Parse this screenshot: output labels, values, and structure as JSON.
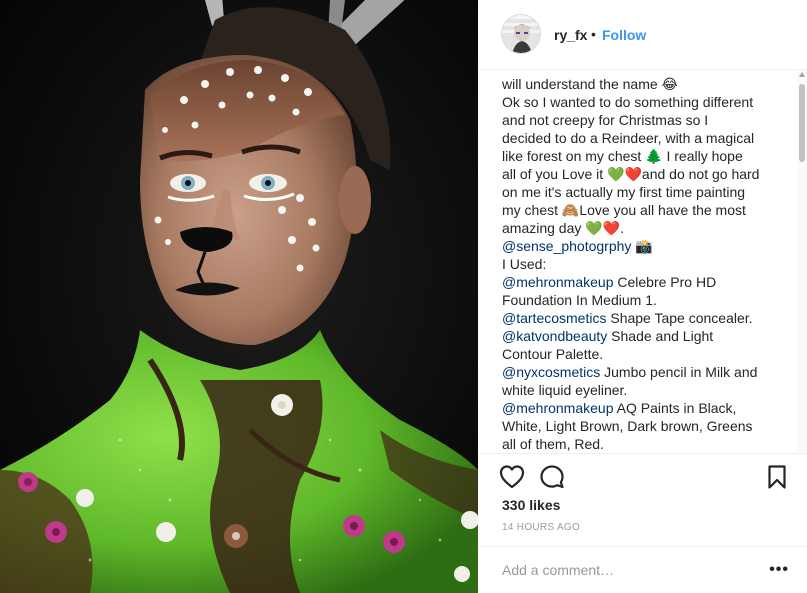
{
  "post": {
    "username": "ry_fx",
    "separator": "•",
    "follow_label": "Follow",
    "caption_lines": [
      [
        {
          "t": "will understand the name 😂"
        }
      ],
      [
        {
          "t": "Ok so I wanted to do something different"
        }
      ],
      [
        {
          "t": "and not creepy for Christmas so I"
        }
      ],
      [
        {
          "t": "decided to do a Reindeer, with a magical"
        }
      ],
      [
        {
          "t": "like forest on my chest 🌲 I really hope"
        }
      ],
      [
        {
          "t": "all of you Love it 💚❤️and do not go hard"
        }
      ],
      [
        {
          "t": "on me it's actually my first time painting"
        }
      ],
      [
        {
          "t": "my chest 🙈Love you all have the most"
        }
      ],
      [
        {
          "t": "amazing day 💚❤️."
        }
      ],
      [
        {
          "t": "@sense_photogrphy",
          "m": true
        },
        {
          "t": " 📸"
        }
      ],
      [
        {
          "t": "I Used:"
        }
      ],
      [
        {
          "t": "@mehronmakeup",
          "m": true
        },
        {
          "t": " Celebre Pro HD"
        }
      ],
      [
        {
          "t": "Foundation In Medium 1."
        }
      ],
      [
        {
          "t": "@tartecosmetics",
          "m": true
        },
        {
          "t": " Shape Tape concealer."
        }
      ],
      [
        {
          "t": "@katvondbeauty",
          "m": true
        },
        {
          "t": " Shade and Light"
        }
      ],
      [
        {
          "t": "Contour Palette."
        }
      ],
      [
        {
          "t": "@nyxcosmetics",
          "m": true
        },
        {
          "t": " Jumbo pencil in Milk and"
        }
      ],
      [
        {
          "t": "white liquid eyeliner."
        }
      ],
      [
        {
          "t": "@mehronmakeup",
          "m": true
        },
        {
          "t": " AQ Paints in Black,"
        }
      ],
      [
        {
          "t": "White, Light Brown, Dark brown, Greens"
        }
      ],
      [
        {
          "t": "all of them, Red."
        }
      ]
    ],
    "likes": "330 likes",
    "time": "14 HOURS AGO",
    "comment_placeholder": "Add a comment…",
    "more_label": "•••"
  },
  "icons": {
    "like": "heart-icon",
    "comment": "comment-icon",
    "save": "bookmark-icon",
    "options": "more-options-icon"
  },
  "colors": {
    "accent": "#3897f0",
    "mention": "#003569",
    "text": "#262626",
    "muted": "#999999",
    "divider": "#efefef"
  }
}
